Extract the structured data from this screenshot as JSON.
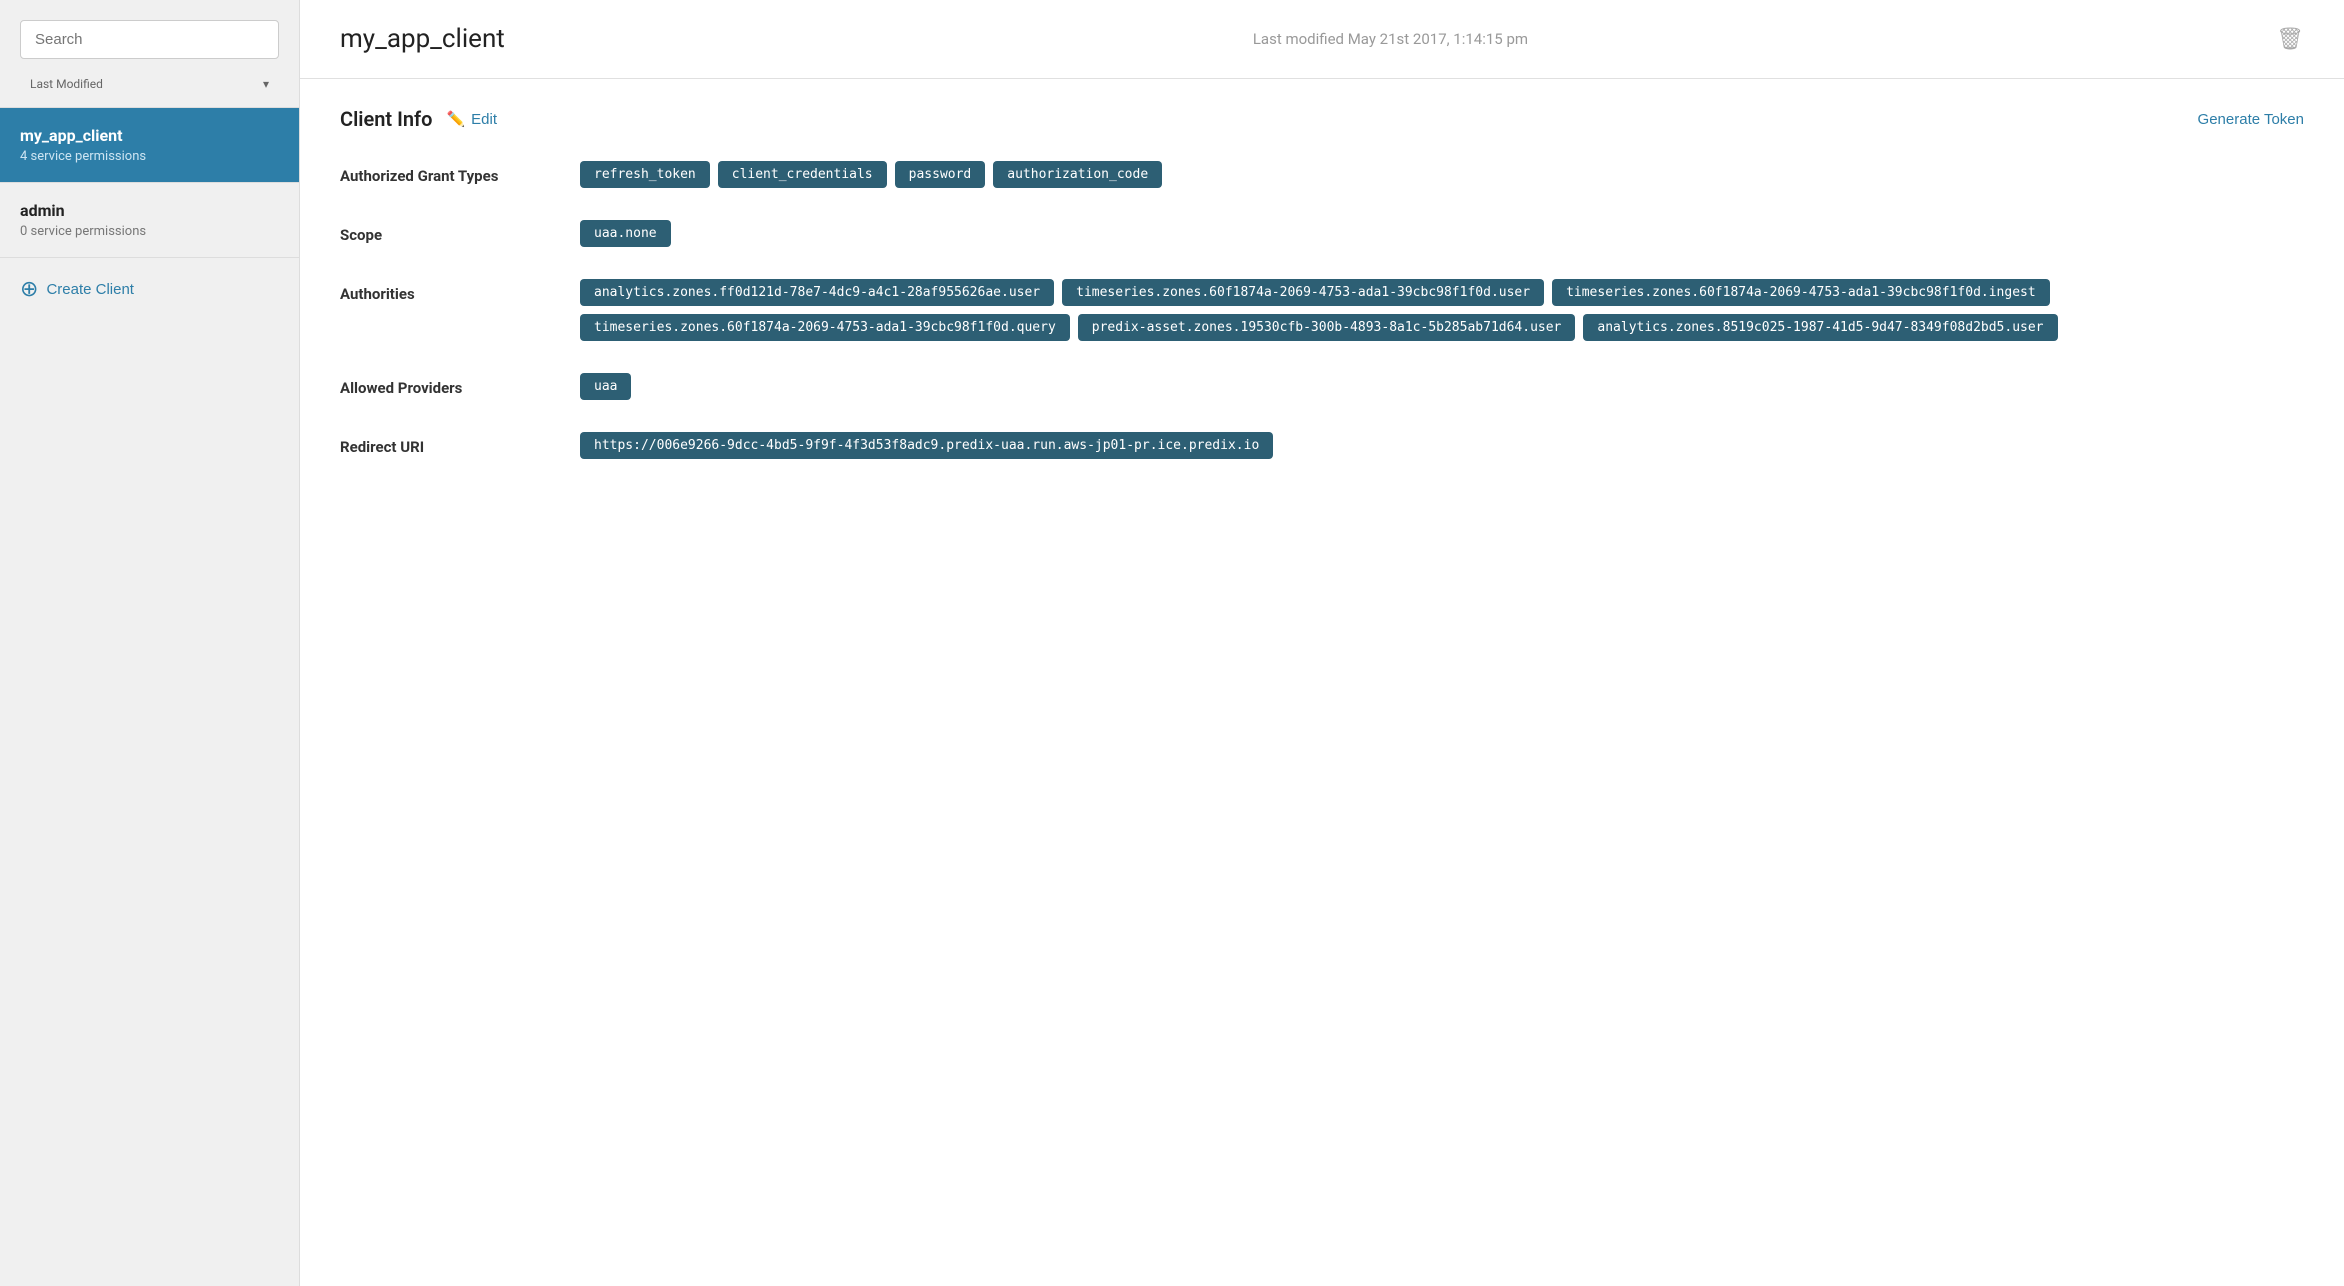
{
  "sidebar": {
    "search_placeholder": "Search",
    "sort_label": "Last Modified",
    "chevron": "▾",
    "clients": [
      {
        "name": "my_app_client",
        "permissions": "4 service permissions",
        "active": true
      },
      {
        "name": "admin",
        "permissions": "0 service permissions",
        "active": false
      }
    ],
    "create_label": "Create Client"
  },
  "main": {
    "header": {
      "title": "my_app_client",
      "last_modified": "Last modified May 21st 2017, 1:14:15 pm",
      "delete_icon": "🗑"
    },
    "section": {
      "title": "Client Info",
      "edit_label": "Edit",
      "generate_token_label": "Generate Token"
    },
    "fields": {
      "authorized_grant_types": {
        "label": "Authorized Grant Types",
        "values": [
          "refresh_token",
          "client_credentials",
          "password",
          "authorization_code"
        ]
      },
      "scope": {
        "label": "Scope",
        "values": [
          "uaa.none"
        ]
      },
      "authorities": {
        "label": "Authorities",
        "values": [
          "analytics.zones.ff0d121d-78e7-4dc9-a4c1-28af955626ae.user",
          "timeseries.zones.60f1874a-2069-4753-ada1-39cbc98f1f0d.user",
          "timeseries.zones.60f1874a-2069-4753-ada1-39cbc98f1f0d.ingest",
          "timeseries.zones.60f1874a-2069-4753-ada1-39cbc98f1f0d.query",
          "predix-asset.zones.19530cfb-300b-4893-8a1c-5b285ab71d64.user",
          "analytics.zones.8519c025-1987-41d5-9d47-8349f08d2bd5.user"
        ]
      },
      "allowed_providers": {
        "label": "Allowed Providers",
        "values": [
          "uaa"
        ]
      },
      "redirect_uri": {
        "label": "Redirect URI",
        "values": [
          "https://006e9266-9dcc-4bd5-9f9f-4f3d53f8adc9.predix-uaa.run.aws-jp01-pr.ice.predix.io"
        ]
      }
    }
  }
}
